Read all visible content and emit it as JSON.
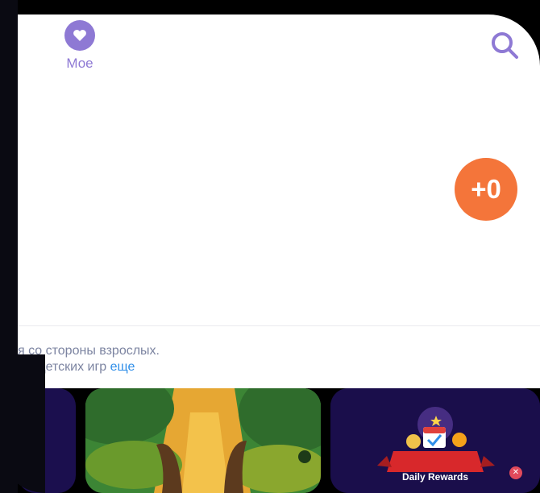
{
  "nav": {
    "moe_label": "Мое"
  },
  "icons": {
    "heart": "heart-icon",
    "search": "search-icon",
    "close": "close-icon"
  },
  "badge": {
    "text": "+0"
  },
  "notice": {
    "line1": "я со стороны взрослых.",
    "line2_prefix": "ды детских игр ",
    "line2_link": "еще"
  },
  "daily_rewards": {
    "label": "Daily Rewards"
  },
  "colors": {
    "accent": "#8e79d4",
    "badge": "#f4753a",
    "link": "#2f8ee8",
    "tile_dark": "#1a0e4b"
  }
}
